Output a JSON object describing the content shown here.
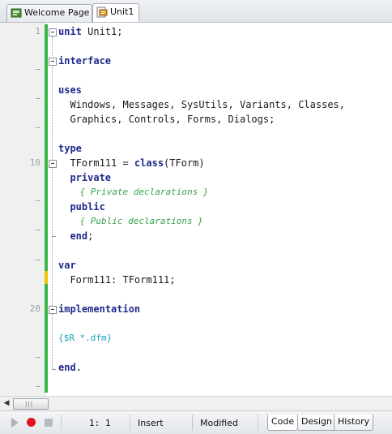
{
  "tabs": [
    {
      "label": "Welcome Page",
      "icon": "welcome-page-icon"
    },
    {
      "label": "Unit1",
      "icon": "unit-file-icon"
    }
  ],
  "line_numbers": [
    "1",
    "10",
    "20"
  ],
  "code": {
    "l1": {
      "kw": "unit",
      "rest": " Unit1;"
    },
    "l2": {
      "kw": "interface"
    },
    "l3": {
      "kw": "uses"
    },
    "l4": {
      "text": "  Windows, Messages, SysUtils, Variants, Classes,"
    },
    "l5": {
      "text": "  Graphics, Controls, Forms, Dialogs;"
    },
    "l6": {
      "kw": "type"
    },
    "l7": {
      "pre": "  TForm111 = ",
      "kw": "class",
      "post": "(TForm)"
    },
    "l8": {
      "kw": "  private"
    },
    "l9": {
      "comment": "    { Private declarations }"
    },
    "l10": {
      "kw": "  public"
    },
    "l11": {
      "comment": "    { Public declarations }"
    },
    "l12": {
      "kw": "  end",
      "post": ";"
    },
    "l13": {
      "kw": "var"
    },
    "l14": {
      "text": "  Form111: TForm111;"
    },
    "l15": {
      "kw": "implementation"
    },
    "l16": {
      "directive": "{$R *.dfm}"
    },
    "l17": {
      "kw": "end",
      "post": "."
    }
  },
  "status": {
    "cursor": "1:  1",
    "mode": "Insert",
    "modified": "Modified"
  },
  "bottom_tabs": [
    "Code",
    "Design",
    "History"
  ],
  "colors": {
    "keyword": "#1f2a8a",
    "comment": "#3aa24a",
    "directive": "#1aa3b8",
    "change_bar": "#3cb54a"
  }
}
